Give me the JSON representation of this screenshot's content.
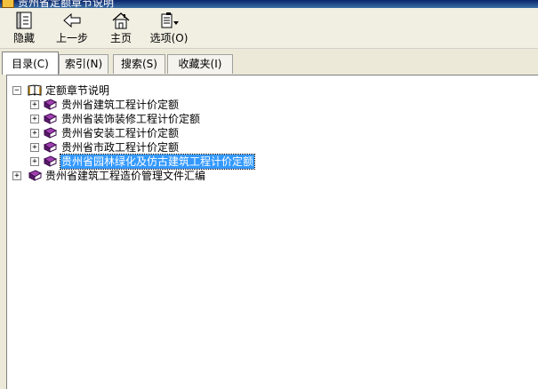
{
  "window": {
    "title": "贵州省定额章节说明"
  },
  "toolbar": {
    "items": [
      {
        "label": "隐藏",
        "icon": "hide-panel-icon"
      },
      {
        "label": "上一步",
        "icon": "back-arrow-icon"
      },
      {
        "label": "主页",
        "icon": "home-icon"
      },
      {
        "label": "选项(O)",
        "icon": "options-icon"
      }
    ]
  },
  "tabs": [
    {
      "label": "目录(C)",
      "active": true
    },
    {
      "label": "索引(N)",
      "active": false
    },
    {
      "label": "搜索(S)",
      "active": false
    },
    {
      "label": "收藏夹(I)",
      "active": false
    }
  ],
  "tree": {
    "root": {
      "label": "定额章节说明",
      "expander": "⊟",
      "icon": "open-book-icon"
    },
    "children": [
      {
        "label": "贵州省建筑工程计价定额",
        "expander": "+",
        "icon": "closed-book-icon",
        "selected": false
      },
      {
        "label": "贵州省装饰装修工程计价定额",
        "expander": "+",
        "icon": "closed-book-icon",
        "selected": false
      },
      {
        "label": "贵州省安装工程计价定额",
        "expander": "+",
        "icon": "closed-book-icon",
        "selected": false
      },
      {
        "label": "贵州省市政工程计价定额",
        "expander": "+",
        "icon": "closed-book-icon",
        "selected": false
      },
      {
        "label": "贵州省园林绿化及仿古建筑工程计价定额",
        "expander": "+",
        "icon": "closed-book-icon",
        "selected": true
      }
    ],
    "sibling": {
      "label": "贵州省建筑工程造价管理文件汇编",
      "expander": "+",
      "icon": "closed-book-icon"
    }
  },
  "colors": {
    "selection": "#3399ff",
    "book": "#7a2b8c",
    "window_bg": "#ece9d8"
  }
}
